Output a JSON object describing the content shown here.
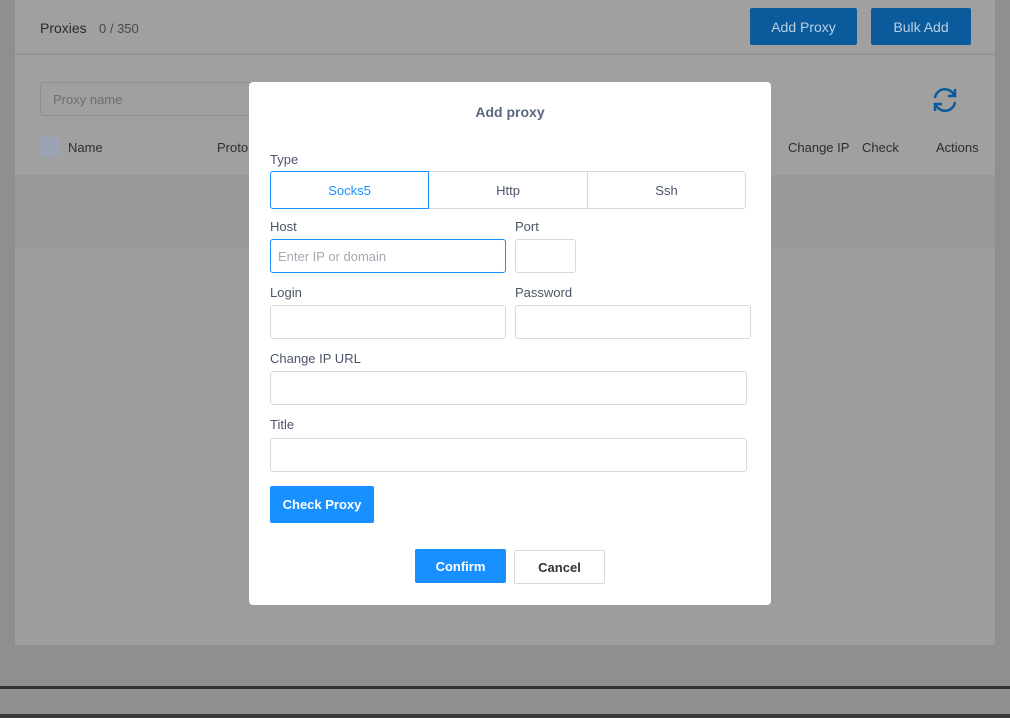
{
  "header": {
    "title": "Proxies",
    "count": "0 / 350",
    "add_proxy": "Add Proxy",
    "bulk_add": "Bulk Add"
  },
  "filters": {
    "search_placeholder": "Proxy name"
  },
  "table": {
    "columns": [
      "Name",
      "Proto",
      "Change IP",
      "Check",
      "Actions"
    ]
  },
  "modal": {
    "title": "Add proxy",
    "type_label": "Type",
    "types": [
      "Socks5",
      "Http",
      "Ssh"
    ],
    "selected_type": "Socks5",
    "host_label": "Host",
    "host_placeholder": "Enter IP or domain",
    "host_value": "",
    "port_label": "Port",
    "port_value": "",
    "login_label": "Login",
    "login_value": "",
    "password_label": "Password",
    "password_value": "",
    "change_ip_label": "Change IP URL",
    "change_ip_value": "",
    "title_label": "Title",
    "title_value": "",
    "check_proxy": "Check Proxy",
    "confirm": "Confirm",
    "cancel": "Cancel"
  },
  "colors": {
    "accent": "#1890ff",
    "overlay": "#9a9a9a"
  },
  "icons": {
    "refresh": "refresh-icon"
  }
}
